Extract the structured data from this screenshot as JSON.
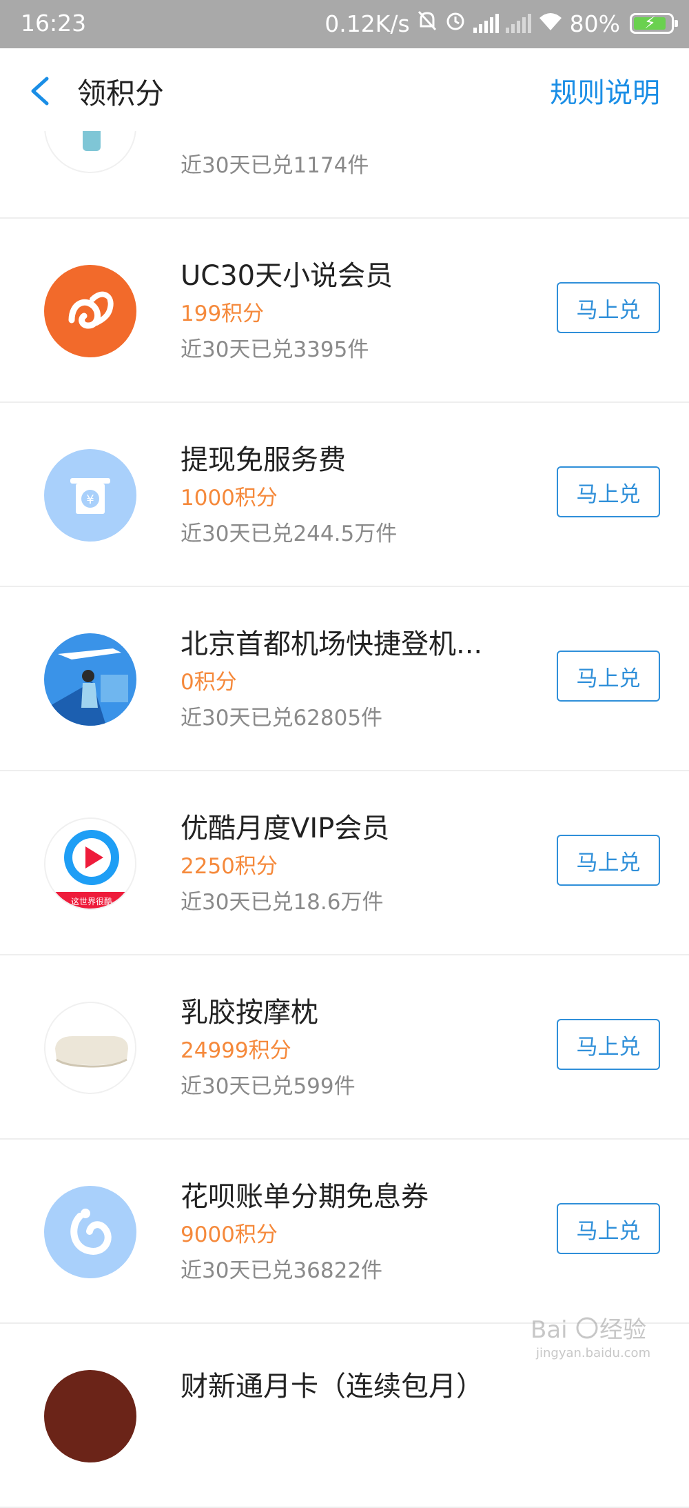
{
  "status_bar": {
    "time": "16:23",
    "net_speed": "0.12K/s",
    "battery": "80%"
  },
  "nav": {
    "title": "领积分",
    "rules_label": "规则说明"
  },
  "items": [
    {
      "name": "",
      "points": "",
      "sold": "近30天已兑1174件",
      "button": ""
    },
    {
      "name": "UC30天小说会员",
      "points": "199积分",
      "sold": "近30天已兑3395件",
      "button": "马上兑"
    },
    {
      "name": "提现免服务费",
      "points": "1000积分",
      "sold": "近30天已兑244.5万件",
      "button": "马上兑"
    },
    {
      "name": "北京首都机场快捷登机...",
      "points": "0积分",
      "sold": "近30天已兑62805件",
      "button": "马上兑"
    },
    {
      "name": "优酷月度VIP会员",
      "points": "2250积分",
      "sold": "近30天已兑18.6万件",
      "button": "马上兑"
    },
    {
      "name": "乳胶按摩枕",
      "points": "24999积分",
      "sold": "近30天已兑599件",
      "button": "马上兑"
    },
    {
      "name": "花呗账单分期免息券",
      "points": "9000积分",
      "sold": "近30天已兑36822件",
      "button": "马上兑"
    },
    {
      "name": "财新通月卡（连续包月）",
      "points": "",
      "sold": "",
      "button": ""
    }
  ],
  "youku_badge": "这世界很酷",
  "watermark": "Baidu经验 jingyan.baidu.com",
  "colors": {
    "accent_blue": "#1a8ee6",
    "points_orange": "#f5893b",
    "uc_orange": "#f26a2b",
    "light_blue_icon": "#a9d0fb"
  }
}
